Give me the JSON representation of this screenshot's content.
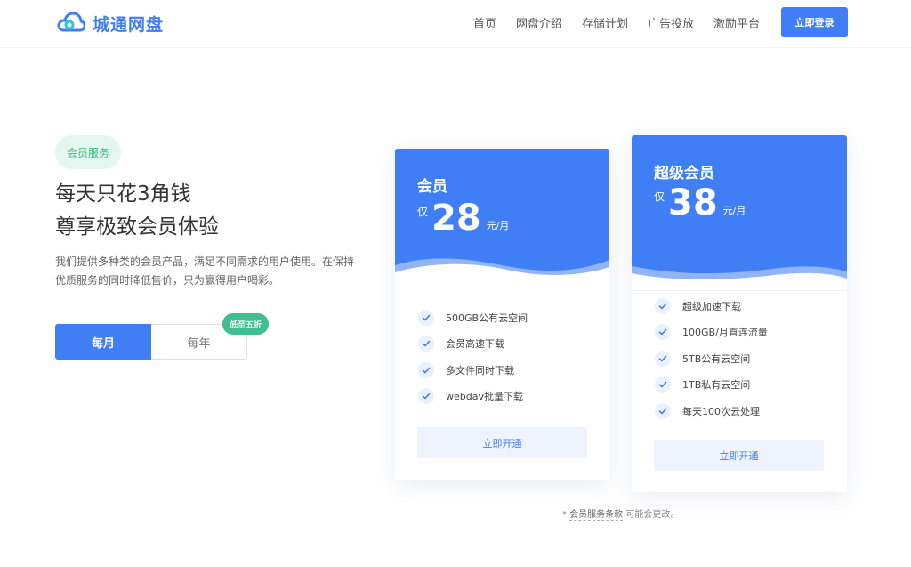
{
  "brand": {
    "name": "城通网盘",
    "color": "#3f7ef5"
  },
  "nav": {
    "items": [
      "首页",
      "网盘介绍",
      "存储计划",
      "广告投放",
      "激励平台"
    ],
    "login": "立即登录"
  },
  "hero": {
    "badge": "会员服务",
    "headline_1": "每天只花3角钱",
    "headline_2": "尊享极致会员体验",
    "description": "我们提供多种类的会员产品，满足不同需求的用户使用。在保持优质服务的同时降低售价，只为赢得用户喝彩。"
  },
  "billing": {
    "monthly": "每月",
    "yearly": "每年",
    "discount": "低至五折"
  },
  "plans": [
    {
      "name": "会员",
      "price_prefix": "仅",
      "price": "28",
      "unit": "元/月",
      "features": [
        "500GB公有云空间",
        "会员高速下载",
        "多文件同时下载",
        "webdav批量下载"
      ],
      "button": "立即开通"
    },
    {
      "name": "超级会员",
      "price_prefix": "仅",
      "price": "38",
      "unit": "元/月",
      "features": [
        "超级加速下载",
        "100GB/月直连流量",
        "5TB公有云空间",
        "1TB私有云空间",
        "每天100次云处理"
      ],
      "button": "立即开通"
    }
  ],
  "terms": {
    "prefix": "* ",
    "link": "会员服务条款",
    "suffix": " 可能会更改。"
  },
  "icons": {
    "logo": "cloud-logo-icon",
    "check": "check-icon"
  }
}
